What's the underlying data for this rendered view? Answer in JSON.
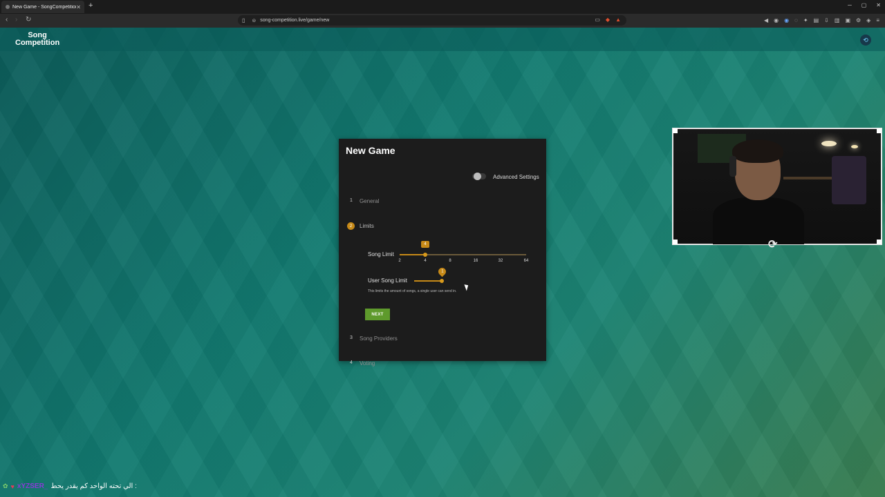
{
  "browser": {
    "tab_title": "New Game - SongCompetition",
    "tab_close": "✕",
    "new_tab": "+",
    "url": "song-competition.live/game/new",
    "window_controls": [
      "─",
      "▢",
      "✕"
    ]
  },
  "site": {
    "logo_line1": "Song",
    "logo_line2": "Competition"
  },
  "card": {
    "title": "New Game",
    "advanced_settings": "Advanced Settings",
    "advanced_enabled": false,
    "steps": [
      {
        "number": "1",
        "label": "General"
      },
      {
        "number": "2",
        "label": "Limits"
      },
      {
        "number": "3",
        "label": "Song Providers"
      },
      {
        "number": "4",
        "label": "Voting"
      }
    ],
    "song_limit": {
      "label": "Song Limit",
      "value": "4",
      "ticks": [
        "2",
        "4",
        "8",
        "16",
        "32",
        "64"
      ]
    },
    "user_song_limit": {
      "label": "User Song Limit",
      "value": "1",
      "helper": "This limits the amount of songs, a single user can send in."
    },
    "next_button": "NEXT"
  },
  "chat": {
    "username": "xYZSER_",
    "message": ": الي تحته الواحد كم يقدر يحط"
  },
  "colors": {
    "accent": "#c78a18",
    "next_button": "#5e9a2c",
    "card_bg": "#1c1c1c"
  }
}
